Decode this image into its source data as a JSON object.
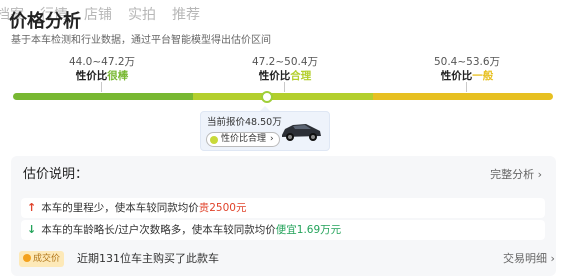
{
  "tabs": [
    "档案",
    "行情",
    "店铺",
    "实拍",
    "推荐"
  ],
  "section": {
    "title": "价格分析",
    "subtitle": "基于本车检测和行业数据，通过平台智能模型得出估价区间"
  },
  "ranges": [
    {
      "value": "44.0~47.2万",
      "label_prefix": "性价比",
      "label_highlight": "很棒",
      "color": "#78b832"
    },
    {
      "value": "47.2~50.4万",
      "label_prefix": "性价比",
      "label_highlight": "合理",
      "color": "#b3cf2d"
    },
    {
      "value": "50.4~53.6万",
      "label_prefix": "性价比",
      "label_highlight": "一般",
      "color": "#e7c021"
    }
  ],
  "current": {
    "label": "当前报价48.50万",
    "verdict": "性价比合理",
    "chevron": "›"
  },
  "explain": {
    "title": "估价说明：",
    "more": "完整分析",
    "more_chevron": "›",
    "items": [
      {
        "text": "本车的里程少，使本车较同款均价",
        "delta": "贵2500元",
        "icon": "arrow-up-icon",
        "color": "#e0432b"
      },
      {
        "text": "本车的车龄略长/过户次数略多，使本车较同款均价",
        "delta": "便宜1.69万元",
        "icon": "arrow-down-icon",
        "color": "#23a35a"
      }
    ]
  },
  "footer": {
    "badge": "成交价",
    "text": "近期131位车主购买了此款车",
    "more": "交易明细",
    "more_chevron": "›"
  }
}
